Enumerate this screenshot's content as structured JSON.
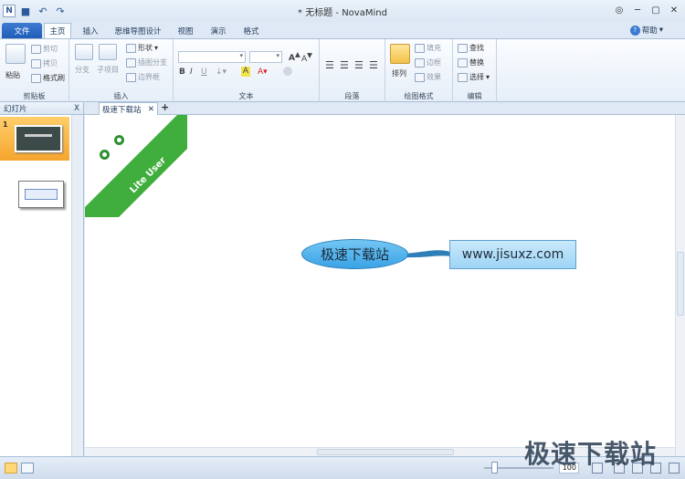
{
  "app": {
    "window_title": "* 无标题 - NovaMind",
    "logo": "N"
  },
  "tabs": {
    "file": "文件",
    "home": "主页",
    "insert": "插入",
    "mindmap_design": "思维导图设计",
    "view": "视图",
    "presentation": "演示",
    "format": "格式",
    "help": "帮助"
  },
  "ribbon": {
    "clipboard": {
      "label": "剪贴板",
      "paste": "粘贴",
      "cut": "剪切",
      "copy": "拷贝",
      "format_painter": "格式刷"
    },
    "insert": {
      "label": "插入",
      "branch": "分支",
      "subtopic": "子项目",
      "shape": "形状",
      "insert_branch": "插图分支",
      "boundary": "边界框"
    },
    "text": {
      "label": "文本",
      "bold": "B",
      "italic": "I",
      "underline": "U"
    },
    "paragraph": {
      "label": "段落"
    },
    "drawing": {
      "label": "绘图格式",
      "arrange": "排列",
      "fill": "填充",
      "border": "边框",
      "effect": "效果"
    },
    "edit": {
      "label": "编辑",
      "find": "查找",
      "replace": "替换",
      "select": "选择"
    }
  },
  "slides_panel": {
    "title": "幻灯片",
    "close": "X",
    "slide_number": "1"
  },
  "document": {
    "tab_title": "极速下载站",
    "tab_close": "✕",
    "add_tab": "+"
  },
  "canvas": {
    "banner_text": "Lite User",
    "central_topic": "极速下载站",
    "sub_topic": "www.jisuxz.com"
  },
  "statusbar": {
    "zoom": "100"
  },
  "watermark": "极速下载站",
  "colors": {
    "banner": "#3fae3c",
    "central_topic": "#3aa3e6",
    "sub_topic": "#9ed4f4"
  }
}
